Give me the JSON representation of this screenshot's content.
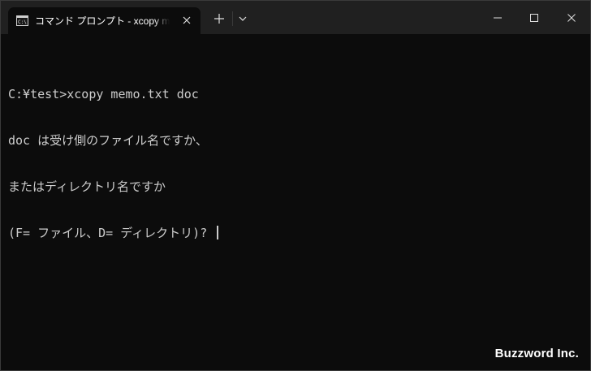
{
  "tab": {
    "title": "コマンド プロンプト - xcopy  memo.txt doc"
  },
  "terminal": {
    "lines": [
      "C:¥test>xcopy memo.txt doc",
      "doc は受け側のファイル名ですか、",
      "またはディレクトリ名ですか",
      "(F= ファイル、D= ディレクトリ)? "
    ]
  },
  "watermark": "Buzzword Inc.",
  "colors": {
    "background": "#0c0c0c",
    "titlebar": "#202020",
    "text": "#cccccc"
  }
}
